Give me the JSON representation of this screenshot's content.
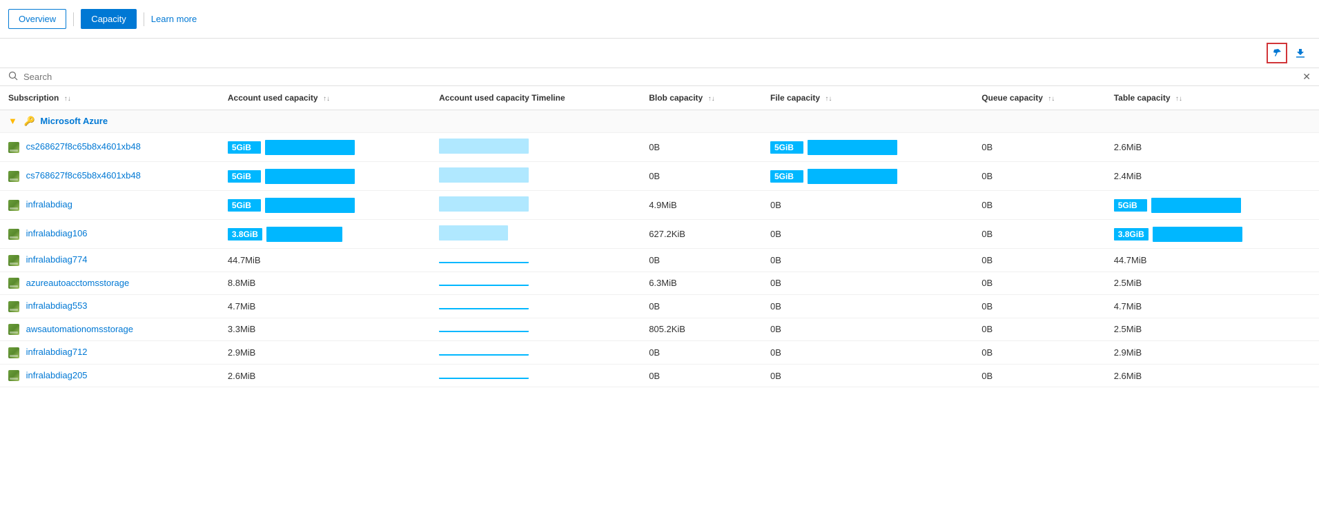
{
  "nav": {
    "overview_label": "Overview",
    "capacity_label": "Capacity",
    "learn_more_label": "Learn more"
  },
  "toolbar": {
    "pin_icon": "📌",
    "download_icon": "⬇"
  },
  "search": {
    "placeholder": "Search",
    "clear_icon": "✕"
  },
  "table": {
    "columns": [
      {
        "id": "subscription",
        "label": "Subscription",
        "sortable": true
      },
      {
        "id": "account_used_capacity",
        "label": "Account used capacity",
        "sortable": true
      },
      {
        "id": "account_used_capacity_timeline",
        "label": "Account used capacity Timeline",
        "sortable": false
      },
      {
        "id": "blob_capacity",
        "label": "Blob capacity",
        "sortable": true
      },
      {
        "id": "file_capacity",
        "label": "File capacity",
        "sortable": true
      },
      {
        "id": "queue_capacity",
        "label": "Queue capacity",
        "sortable": true
      },
      {
        "id": "table_capacity",
        "label": "Table capacity",
        "sortable": true
      }
    ],
    "group": {
      "name": "Microsoft Azure",
      "icon": "🔑"
    },
    "rows": [
      {
        "name": "cs268627f8c65b8x4601xb48",
        "account_used_capacity": "5GiB",
        "account_capacity_bar": "full",
        "timeline_bar": "tl-large",
        "blob_capacity": "0B",
        "file_capacity_bar": true,
        "file_capacity": "5GiB",
        "queue_capacity": "0B",
        "table_capacity": "2.6MiB",
        "table_capacity_bar": false
      },
      {
        "name": "cs768627f8c65b8x4601xb48",
        "account_used_capacity": "5GiB",
        "account_capacity_bar": "full",
        "timeline_bar": "tl-large",
        "blob_capacity": "0B",
        "file_capacity_bar": true,
        "file_capacity": "5GiB",
        "queue_capacity": "0B",
        "table_capacity": "2.4MiB",
        "table_capacity_bar": false
      },
      {
        "name": "infralabdiag",
        "account_used_capacity": "5GiB",
        "account_capacity_bar": "full",
        "timeline_bar": "tl-large",
        "blob_capacity": "4.9MiB",
        "file_capacity_bar": false,
        "file_capacity": "0B",
        "queue_capacity": "0B",
        "table_capacity": "5GiB",
        "table_capacity_bar": true
      },
      {
        "name": "infralabdiag106",
        "account_used_capacity": "3.8GiB",
        "account_capacity_bar": "large",
        "timeline_bar": "tl-medium",
        "blob_capacity": "627.2KiB",
        "file_capacity_bar": false,
        "file_capacity": "0B",
        "queue_capacity": "0B",
        "table_capacity": "3.8GiB",
        "table_capacity_bar": true
      },
      {
        "name": "infralabdiag774",
        "account_used_capacity": "44.7MiB",
        "account_capacity_bar": null,
        "timeline_bar": "tl-line",
        "blob_capacity": "0B",
        "file_capacity_bar": false,
        "file_capacity": "0B",
        "queue_capacity": "0B",
        "table_capacity": "44.7MiB",
        "table_capacity_bar": false
      },
      {
        "name": "azureautoacctomsstorage",
        "account_used_capacity": "8.8MiB",
        "account_capacity_bar": null,
        "timeline_bar": "tl-line",
        "blob_capacity": "6.3MiB",
        "file_capacity_bar": false,
        "file_capacity": "0B",
        "queue_capacity": "0B",
        "table_capacity": "2.5MiB",
        "table_capacity_bar": false
      },
      {
        "name": "infralabdiag553",
        "account_used_capacity": "4.7MiB",
        "account_capacity_bar": null,
        "timeline_bar": "tl-line",
        "blob_capacity": "0B",
        "file_capacity_bar": false,
        "file_capacity": "0B",
        "queue_capacity": "0B",
        "table_capacity": "4.7MiB",
        "table_capacity_bar": false
      },
      {
        "name": "awsautomationomsstorage",
        "account_used_capacity": "3.3MiB",
        "account_capacity_bar": null,
        "timeline_bar": "tl-line",
        "blob_capacity": "805.2KiB",
        "file_capacity_bar": false,
        "file_capacity": "0B",
        "queue_capacity": "0B",
        "table_capacity": "2.5MiB",
        "table_capacity_bar": false
      },
      {
        "name": "infralabdiag712",
        "account_used_capacity": "2.9MiB",
        "account_capacity_bar": null,
        "timeline_bar": "tl-line",
        "blob_capacity": "0B",
        "file_capacity_bar": false,
        "file_capacity": "0B",
        "queue_capacity": "0B",
        "table_capacity": "2.9MiB",
        "table_capacity_bar": false
      },
      {
        "name": "infralabdiag205",
        "account_used_capacity": "2.6MiB",
        "account_capacity_bar": null,
        "timeline_bar": "tl-line",
        "blob_capacity": "0B",
        "file_capacity_bar": false,
        "file_capacity": "0B",
        "queue_capacity": "0B",
        "table_capacity": "2.6MiB",
        "table_capacity_bar": false
      }
    ]
  }
}
